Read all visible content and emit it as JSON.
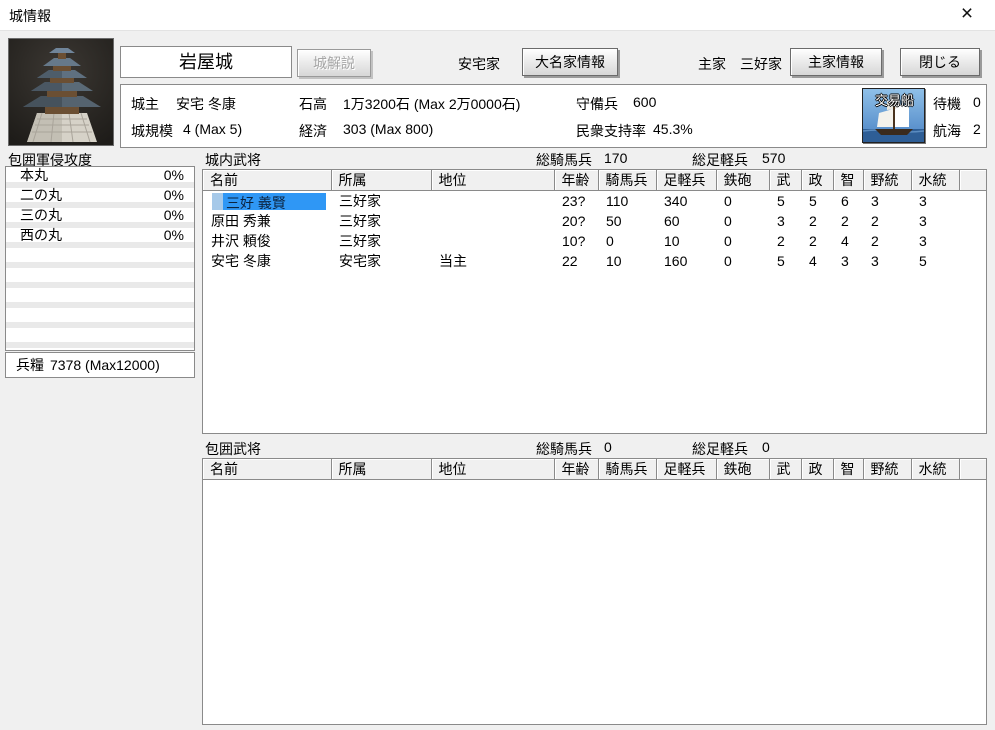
{
  "window": {
    "title": "城情報",
    "close_glyph": "×"
  },
  "header": {
    "castle_name": "岩屋城",
    "castle_desc_button": "城解説",
    "clan_name": "安宅家",
    "daimyo_info_button": "大名家情報",
    "liege_label": "主家",
    "liege_name": "三好家",
    "liege_info_button": "主家情報",
    "close_button": "閉じる"
  },
  "castle_info": {
    "lord_label": "城主",
    "lord_value": "安宅 冬康",
    "kokudaka_label": "石高",
    "kokudaka_value": "1万3200石 (Max 2万0000石)",
    "garrison_label": "守備兵",
    "garrison_value": "600",
    "scale_label": "城規模",
    "scale_value": "4 (Max 5)",
    "economy_label": "経済",
    "economy_value": "303 (Max 800)",
    "support_label": "民衆支持率",
    "support_value": "45.3%",
    "trade_ship_label": "交易船",
    "waiting_label": "待機",
    "waiting_value": "0",
    "voyage_label": "航海",
    "voyage_value": "2"
  },
  "siege_panel": {
    "title": "包囲軍侵攻度",
    "rows": [
      {
        "name": "本丸",
        "value": "0%"
      },
      {
        "name": "二の丸",
        "value": "0%"
      },
      {
        "name": "三の丸",
        "value": "0%"
      },
      {
        "name": "西の丸",
        "value": "0%"
      }
    ],
    "provisions_label": "兵糧",
    "provisions_value": "7378 (Max12000)"
  },
  "castle_officers": {
    "title": "城内武将",
    "total_cavalry_label": "総騎馬兵",
    "total_cavalry": "170",
    "total_foot_label": "総足軽兵",
    "total_foot": "570",
    "columns": [
      "名前",
      "所属",
      "地位",
      "年齢",
      "騎馬兵",
      "足軽兵",
      "鉄砲",
      "武",
      "政",
      "智",
      "野統",
      "水統"
    ],
    "rows": [
      {
        "name": "三好 義賢",
        "clan": "三好家",
        "rank": "",
        "age": "23?",
        "cavalry": "110",
        "foot": "340",
        "guns": "0",
        "war": "5",
        "pol": "5",
        "int": "6",
        "field": "3",
        "naval": "3",
        "selected": true
      },
      {
        "name": "原田 秀兼",
        "clan": "三好家",
        "rank": "",
        "age": "20?",
        "cavalry": "50",
        "foot": "60",
        "guns": "0",
        "war": "3",
        "pol": "2",
        "int": "2",
        "field": "2",
        "naval": "3"
      },
      {
        "name": "井沢 頼俊",
        "clan": "三好家",
        "rank": "",
        "age": "10?",
        "cavalry": "0",
        "foot": "10",
        "guns": "0",
        "war": "2",
        "pol": "2",
        "int": "4",
        "field": "2",
        "naval": "3"
      },
      {
        "name": "安宅 冬康",
        "clan": "安宅家",
        "rank": "当主",
        "age": "22",
        "cavalry": "10",
        "foot": "160",
        "guns": "0",
        "war": "5",
        "pol": "4",
        "int": "3",
        "field": "3",
        "naval": "5"
      }
    ]
  },
  "siege_officers": {
    "title": "包囲武将",
    "total_cavalry_label": "総騎馬兵",
    "total_cavalry": "0",
    "total_foot_label": "総足軽兵",
    "total_foot": "0",
    "columns": [
      "名前",
      "所属",
      "地位",
      "年齢",
      "騎馬兵",
      "足軽兵",
      "鉄砲",
      "武",
      "政",
      "智",
      "野統",
      "水統"
    ],
    "rows": []
  },
  "colors": {
    "selection_bg": "#2f97f5",
    "selection_lead": "#a6c9e9",
    "dialog_bg": "#f0f0f0",
    "box_border": "#8a8a8a"
  }
}
